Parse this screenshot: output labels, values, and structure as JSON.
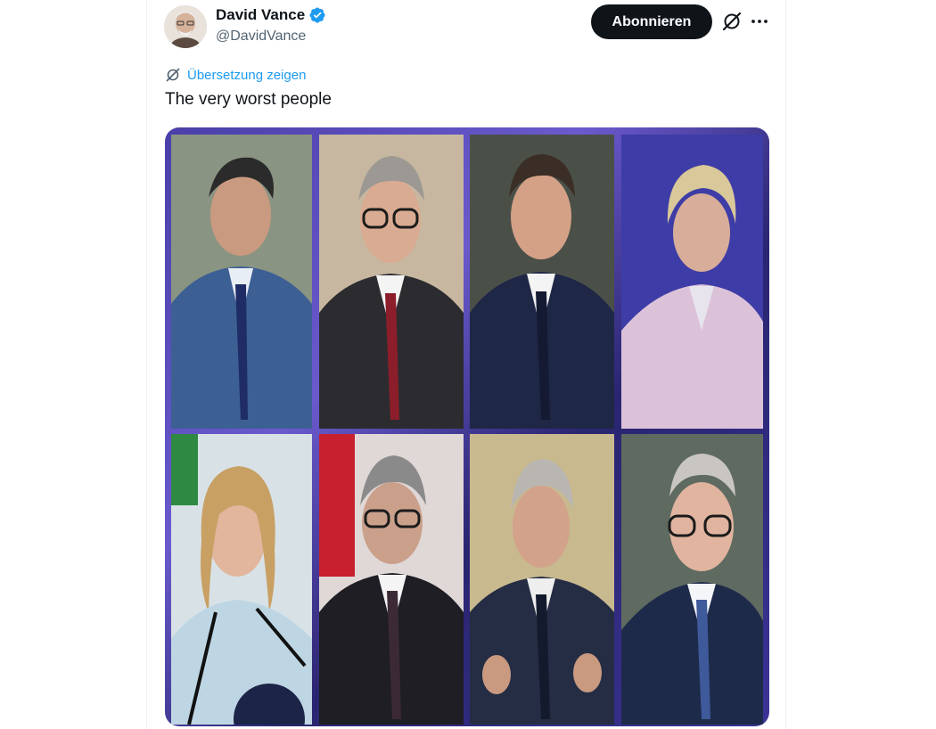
{
  "author": {
    "name": "David Vance",
    "handle": "@DavidVance"
  },
  "actions": {
    "subscribe_label": "Abonnieren",
    "grok_icon": "grok-icon",
    "more_icon": "more-options-icon"
  },
  "translate": {
    "label": "Übersetzung zeigen",
    "icon": "translate-icon"
  },
  "tweet": {
    "text": "The very worst people"
  },
  "colors": {
    "button_bg": "#0f1419",
    "link": "#1d9bf0",
    "verified": "#1d9bf0",
    "handle": "#536471"
  },
  "media": {
    "type": "photo-collage",
    "tiles": 8
  }
}
